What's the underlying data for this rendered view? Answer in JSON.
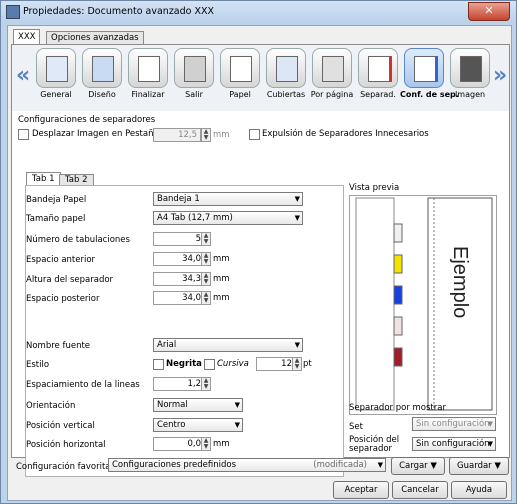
{
  "window": {
    "title": "Propiedades: Documento avanzado XXX",
    "close": "✕"
  },
  "outer_tabs": [
    "XXX",
    "Opciones avanzadas"
  ],
  "toolbar": {
    "items": [
      "General",
      "Diseño",
      "Finalizar",
      "Salir",
      "Papel",
      "Cubiertas",
      "Por página",
      "Separad.",
      "Conf. de sep.",
      "Imagen"
    ],
    "selected": "Conf. de sep.",
    "left_arrow": "«",
    "right_arrow": "»"
  },
  "sep_config": {
    "heading": "Configuraciones de separadores",
    "shift_label": "Desplazar Imagen en Pestaña",
    "shift_value": "12,5",
    "shift_unit": "mm",
    "eject_label": "Expulsión de Separadores Innecesarios"
  },
  "inner_tabs": [
    "Tab 1",
    "Tab 2"
  ],
  "form": {
    "tray_label": "Bandeja Papel",
    "tray_value": "Bandeja 1",
    "size_label": "Tamaño papel",
    "size_value": "A4 Tab (12,7 mm)",
    "tabs_label": "Número de tabulaciones",
    "tabs_value": "5",
    "front_label": "Espacio anterior",
    "front_value": "34,0",
    "front_unit": "mm",
    "height_label": "Altura del separador",
    "height_value": "34,3",
    "height_unit": "mm",
    "back_label": "Espacio posterior",
    "back_value": "34,0",
    "back_unit": "mm",
    "font_label": "Nombre fuente",
    "font_value": "Arial",
    "style_label": "Estilo",
    "bold_label": "Negrita",
    "italic_label": "Cursiva",
    "size_pt": "12",
    "pt_unit": "pt",
    "spacing_label": "Espaciamiento de la lineas",
    "spacing_value": "1,2",
    "orient_label": "Orientación",
    "orient_value": "Normal",
    "vpos_label": "Posición vertical",
    "vpos_value": "Centro",
    "hpos_label": "Posición horizontal",
    "hpos_value": "0,0",
    "hpos_unit": "mm"
  },
  "preview": {
    "heading": "Vista previa",
    "sample_text": "Ejemplo",
    "tab_colors": [
      "#f0f0f0",
      "#f2e200",
      "#1a3fe0",
      "#efe4e2",
      "#a01c2a"
    ],
    "show_label": "Separador por mostrar",
    "set_label": "Set",
    "set_value": "Sin configuración",
    "pos_label": "Posición del separador",
    "pos_value": "Sin configuración"
  },
  "favorites": {
    "label": "Configuración favorita",
    "value": "Configuraciones predefinidos",
    "modified": "(modificada)",
    "load": "Cargar",
    "save": "Guardar"
  },
  "buttons": {
    "ok": "Aceptar",
    "cancel": "Cancelar",
    "help": "Ayuda"
  }
}
